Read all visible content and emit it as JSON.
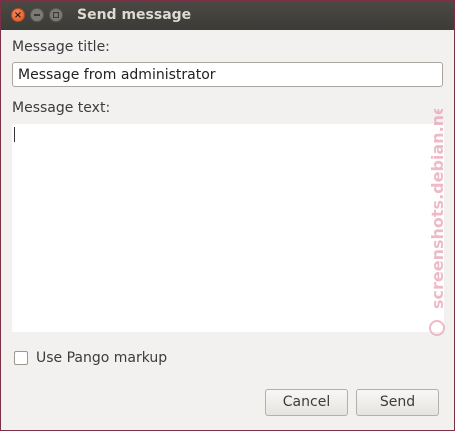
{
  "window": {
    "title": "Send message",
    "controls": {
      "close": "close-icon",
      "minimize": "minimize-icon",
      "maximize": "maximize-icon"
    }
  },
  "form": {
    "title_label": "Message title:",
    "title_value": "Message from administrator",
    "text_label": "Message text:",
    "text_value": "",
    "pango_label": "Use Pango markup",
    "pango_checked": false
  },
  "buttons": {
    "cancel": "Cancel",
    "send": "Send"
  },
  "watermark": {
    "text": "screenshots.debian.net"
  },
  "colors": {
    "titlebar": "#3c3b37",
    "close_button": "#e0561f",
    "window_bg": "#f2f1f0",
    "watermark": "#e8a3b6"
  }
}
